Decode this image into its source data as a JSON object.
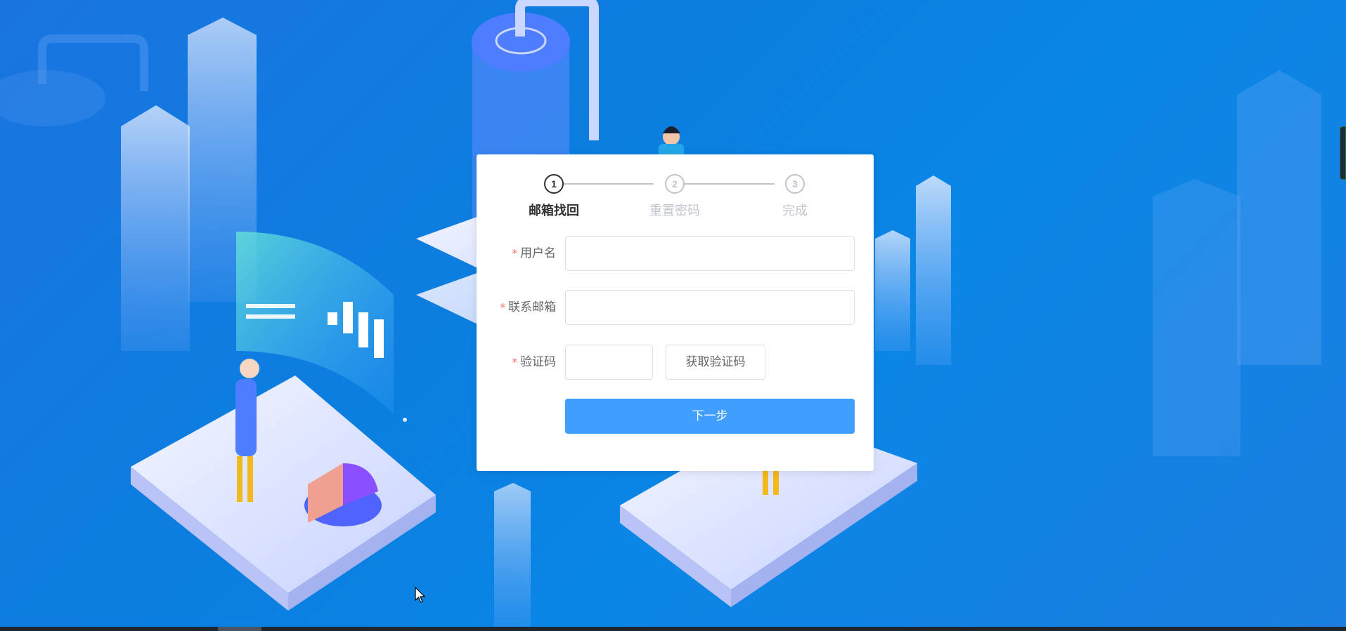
{
  "steps": [
    {
      "number": "1",
      "label": "邮箱找回",
      "active": true
    },
    {
      "number": "2",
      "label": "重置密码",
      "active": false
    },
    {
      "number": "3",
      "label": "完成",
      "active": false
    }
  ],
  "form": {
    "required_mark": "*",
    "username_label": "用户名",
    "username_value": "",
    "email_label": "联系邮箱",
    "email_value": "",
    "code_label": "验证码",
    "code_value": "",
    "get_code_label": "获取验证码",
    "next_label": "下一步"
  },
  "colors": {
    "primary": "#409eff",
    "required": "#f56c6c",
    "active_step": "#303133",
    "inactive_step": "#c0c4cc",
    "background": "#0a86e6"
  }
}
